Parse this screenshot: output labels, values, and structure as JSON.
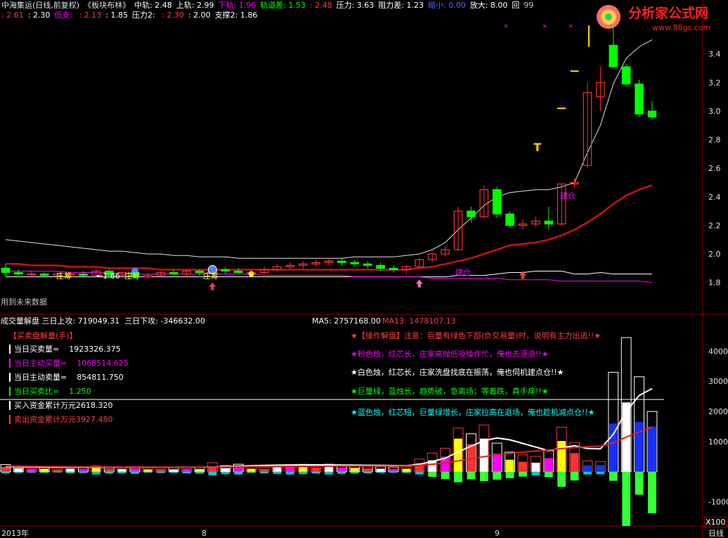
{
  "header": {
    "line1": [
      {
        "text": "中海集运(日线,前复权)",
        "color": "#e0e0e0"
      },
      {
        "text": "《板块布林》",
        "color": "#e0e0e0"
      },
      {
        "text": "中轨: 2.48",
        "color": "#ffffff"
      },
      {
        "text": "上轨: 2.99",
        "color": "#ffffff"
      },
      {
        "text": "下轨: 1.96",
        "color": "#ff00ff"
      },
      {
        "text": "轨道差: 1.53",
        "color": "#00ff00"
      },
      {
        "text": ": 2.48",
        "color": "#ff3c3c"
      },
      {
        "text": "压力: 3.63",
        "color": "#ffffff"
      },
      {
        "text": "阻力差: 1.23",
        "color": "#ffffff"
      },
      {
        "text": "缩小: 0.00",
        "color": "#4b6bff"
      },
      {
        "text": "放大: 8.00",
        "color": "#ffffff"
      },
      {
        "text": "回",
        "color": "#ffffff"
      },
      {
        "text": "99",
        "color": "#c0c0c0"
      }
    ],
    "line2": [
      {
        "text": ": 2.61",
        "color": "#ff3c3c"
      },
      {
        "text": ": 2.30",
        "color": "#ffffff"
      },
      {
        "text": "低支: ",
        "color": "#ff00ff"
      },
      {
        "text": ": 2.13",
        "color": "#ff3c3c"
      },
      {
        "text": ": 1.85",
        "color": "#ffffff"
      },
      {
        "text": "压力2: ",
        "color": "#ffffff"
      },
      {
        "text": ": 2.30",
        "color": "#ff3c3c"
      },
      {
        "text": ": 2.00",
        "color": "#ffffff"
      },
      {
        "text": "支撑2: 1.86",
        "color": "#ffffff"
      }
    ]
  },
  "logo": {
    "text": "分析家公式网",
    "url": "www.88gs.com"
  },
  "price_axis": {
    "ticks": [
      "3.4",
      "3.2",
      "3.0",
      "2.8",
      "2.6",
      "2.4",
      "2.2",
      "2.0",
      "1.8"
    ]
  },
  "price_labels": {
    "zhuangchou": "庄筹",
    "low_value": "1.86",
    "jiancang_upper": "建仓",
    "jiancang_lower": "建仓",
    "future_data": "用到未来数据"
  },
  "volume_panel": {
    "title": "成交量解盘",
    "up_attack": "三日上攻: 719049.31",
    "down_attack": "三日下攻: -346632.00",
    "ma5": "MA5: 2757168.00",
    "ma13": "MA13: 1478107.13",
    "axis_ticks": [
      "4000",
      "3000",
      "2000",
      "1000",
      "-1000"
    ],
    "unit": "X100",
    "left_rows": [
      {
        "label": "【买卖盘解量(手)】",
        "value": "",
        "color": "#ff3c3c"
      },
      {
        "label": "当日买卖量=",
        "value": "1923326.375",
        "color": "#ffffff"
      },
      {
        "label": "当日主动买量=",
        "value": "1068514.625",
        "color": "#ff00ff"
      },
      {
        "label": "当日主动卖量=",
        "value": "854811.750",
        "color": "#ffffff"
      },
      {
        "label": "当日买卖比=",
        "value": "1.250",
        "color": "#00ff00"
      },
      {
        "label": "买入资金累计万元",
        "value": "2618.320",
        "color": "#ffffff"
      },
      {
        "label": "卖出资金累计万元",
        "value": "3927.480",
        "color": "#ff3c3c"
      }
    ],
    "notes": [
      {
        "text": "★【操作解盘】注意：巨量有绿色下部(负交易量)时，说明有主力出逃!!★",
        "color": "#ff3c3c"
      },
      {
        "text": "★粉色烛，红芯长，庄家高抛低吸操作忙，俺也去逐浪!!★",
        "color": "#ff00ff"
      },
      {
        "text": "★白色烛，红芯长，庄家洗盘找底在振荡，俺也伺机建点仓!!★",
        "color": "#ffffff"
      },
      {
        "text": "★巨量绿，蓝烛长，趋势破，急离场；等着跌，真手痒!!★",
        "color": "#00ff00"
      },
      {
        "text": "★蓝色烛，红芯短，巨量绿增长，庄家拉高在退场，俺也趁机减点仓!!★",
        "color": "#00ffff"
      }
    ]
  },
  "time_axis": {
    "labels": [
      "2013年",
      "8",
      "9"
    ],
    "period": "日线"
  },
  "chart_data": [
    {
      "type": "candlestick",
      "title": "中海集运(日线,前复权)",
      "ylim": [
        1.72,
        3.63
      ],
      "candles": [
        [
          1.9,
          1.93,
          1.84,
          1.87
        ],
        [
          1.87,
          1.89,
          1.85,
          1.86
        ],
        [
          1.86,
          1.88,
          1.84,
          1.86
        ],
        [
          1.86,
          1.87,
          1.84,
          1.85
        ],
        [
          1.85,
          1.87,
          1.84,
          1.86
        ],
        [
          1.86,
          1.88,
          1.85,
          1.86
        ],
        [
          1.86,
          1.88,
          1.84,
          1.85
        ],
        [
          1.85,
          1.9,
          1.84,
          1.88
        ],
        [
          1.88,
          1.89,
          1.84,
          1.85
        ],
        [
          1.85,
          1.88,
          1.84,
          1.87
        ],
        [
          1.87,
          1.88,
          1.83,
          1.84
        ],
        [
          1.84,
          1.86,
          1.83,
          1.85
        ],
        [
          1.85,
          1.88,
          1.84,
          1.87
        ],
        [
          1.87,
          1.89,
          1.85,
          1.86
        ],
        [
          1.86,
          1.88,
          1.84,
          1.88
        ],
        [
          1.88,
          1.89,
          1.85,
          1.87
        ],
        [
          1.87,
          1.9,
          1.86,
          1.89
        ],
        [
          1.89,
          1.91,
          1.86,
          1.88
        ],
        [
          1.88,
          1.9,
          1.86,
          1.87
        ],
        [
          1.87,
          1.89,
          1.85,
          1.87
        ],
        [
          1.87,
          1.91,
          1.86,
          1.89
        ],
        [
          1.89,
          1.93,
          1.88,
          1.91
        ],
        [
          1.91,
          1.94,
          1.89,
          1.92
        ],
        [
          1.92,
          1.95,
          1.9,
          1.93
        ],
        [
          1.93,
          1.96,
          1.91,
          1.94
        ],
        [
          1.94,
          1.97,
          1.92,
          1.95
        ],
        [
          1.95,
          1.97,
          1.92,
          1.94
        ],
        [
          1.94,
          1.96,
          1.91,
          1.93
        ],
        [
          1.93,
          1.95,
          1.9,
          1.92
        ],
        [
          1.92,
          1.94,
          1.88,
          1.9
        ],
        [
          1.9,
          1.92,
          1.87,
          1.89
        ],
        [
          1.89,
          1.92,
          1.86,
          1.91
        ],
        [
          1.91,
          1.97,
          1.9,
          1.96
        ],
        [
          1.96,
          2.01,
          1.94,
          2.0
        ],
        [
          2.0,
          2.05,
          1.98,
          2.03
        ],
        [
          2.03,
          2.33,
          2.02,
          2.3
        ],
        [
          2.3,
          2.33,
          2.22,
          2.26
        ],
        [
          2.26,
          2.48,
          2.25,
          2.45
        ],
        [
          2.45,
          2.47,
          2.25,
          2.28
        ],
        [
          2.28,
          2.3,
          2.18,
          2.2
        ],
        [
          2.2,
          2.24,
          2.17,
          2.21
        ],
        [
          2.21,
          2.26,
          2.19,
          2.23
        ],
        [
          2.23,
          2.33,
          2.17,
          2.21
        ],
        [
          2.21,
          2.49,
          2.2,
          2.49
        ],
        [
          2.49,
          2.53,
          2.46,
          2.5
        ],
        [
          2.62,
          3.2,
          2.6,
          3.13
        ],
        [
          3.1,
          3.31,
          3.0,
          3.2
        ],
        [
          3.46,
          3.6,
          3.3,
          3.31
        ],
        [
          3.31,
          3.33,
          3.17,
          3.19
        ],
        [
          3.19,
          3.22,
          2.96,
          2.98
        ],
        [
          3.0,
          3.07,
          2.94,
          2.96
        ]
      ],
      "series": [
        {
          "name": "上轨",
          "values": [
            2.1,
            2.09,
            2.08,
            2.07,
            2.06,
            2.05,
            2.04,
            2.03,
            2.02,
            2.02,
            2.01,
            2.0,
            2.0,
            1.99,
            1.99,
            1.98,
            1.98,
            1.98,
            1.97,
            1.97,
            1.97,
            1.97,
            1.97,
            1.97,
            1.97,
            1.97,
            1.97,
            1.98,
            1.98,
            1.98,
            1.98,
            1.99,
            2.0,
            2.03,
            2.08,
            2.17,
            2.25,
            2.34,
            2.4,
            2.43,
            2.44,
            2.45,
            2.45,
            2.47,
            2.5,
            2.71,
            2.9,
            3.19,
            3.37,
            3.45,
            3.5
          ]
        },
        {
          "name": "下轨",
          "values": [
            1.84,
            1.84,
            1.84,
            1.84,
            1.84,
            1.84,
            1.84,
            1.84,
            1.84,
            1.84,
            1.84,
            1.84,
            1.84,
            1.84,
            1.84,
            1.84,
            1.84,
            1.84,
            1.84,
            1.84,
            1.84,
            1.84,
            1.84,
            1.84,
            1.84,
            1.84,
            1.84,
            1.84,
            1.84,
            1.84,
            1.84,
            1.84,
            1.84,
            1.84,
            1.84,
            1.85,
            1.85,
            1.85,
            1.86,
            1.87,
            1.87,
            1.88,
            1.88,
            1.88,
            1.86,
            1.86,
            1.87,
            1.86,
            1.86,
            1.86,
            1.86
          ]
        },
        {
          "name": "中轨",
          "values": [
            1.93,
            1.93,
            1.92,
            1.92,
            1.92,
            1.91,
            1.91,
            1.91,
            1.9,
            1.9,
            1.9,
            1.9,
            1.89,
            1.89,
            1.89,
            1.89,
            1.89,
            1.89,
            1.89,
            1.89,
            1.89,
            1.89,
            1.89,
            1.89,
            1.89,
            1.89,
            1.89,
            1.89,
            1.89,
            1.89,
            1.89,
            1.89,
            1.9,
            1.91,
            1.93,
            1.95,
            1.97,
            2.0,
            2.03,
            2.06,
            2.07,
            2.08,
            2.1,
            2.13,
            2.17,
            2.22,
            2.28,
            2.35,
            2.41,
            2.45,
            2.48
          ]
        },
        {
          "name": "轨道差",
          "values": [
            1.88,
            1.88,
            1.88,
            1.88,
            1.88,
            1.87,
            1.87,
            1.87,
            1.87,
            1.86,
            1.86,
            1.86,
            1.86,
            1.86,
            1.86,
            1.86,
            1.86,
            1.86,
            1.86,
            1.86,
            1.85,
            1.85,
            1.85,
            1.85,
            1.85,
            1.85,
            1.85,
            1.84,
            1.84,
            1.84,
            1.84,
            1.84,
            1.84,
            1.83,
            1.83,
            1.83,
            1.83,
            1.83,
            1.83,
            1.82,
            1.82,
            1.82,
            1.82,
            1.81,
            1.81,
            1.81,
            1.81,
            1.81,
            1.81,
            1.81,
            1.8
          ]
        }
      ]
    },
    {
      "type": "bar",
      "title": "成交量解盘",
      "ylim": [
        -1800,
        4800
      ],
      "series": [
        {
          "name": "成交量",
          "values": [
            240,
            180,
            160,
            150,
            130,
            150,
            140,
            200,
            160,
            150,
            170,
            130,
            150,
            140,
            160,
            150,
            300,
            200,
            250,
            160,
            150,
            220,
            240,
            250,
            210,
            260,
            220,
            200,
            180,
            170,
            160,
            170,
            420,
            620,
            780,
            1450,
            1260,
            1550,
            950,
            650,
            560,
            510,
            700,
            1480,
            970,
            360,
            340,
            3300,
            4450,
            3150,
            2000
          ]
        },
        {
          "name": "主动买",
          "values": [
            160,
            120,
            110,
            100,
            80,
            100,
            90,
            140,
            100,
            90,
            110,
            80,
            90,
            80,
            100,
            90,
            180,
            120,
            160,
            100,
            90,
            150,
            160,
            170,
            140,
            180,
            140,
            130,
            110,
            100,
            90,
            100,
            280,
            380,
            500,
            1100,
            920,
            1100,
            600,
            400,
            330,
            300,
            450,
            1020,
            620,
            210,
            220,
            1600,
            2300,
            1650,
            1500
          ]
        },
        {
          "name": "主动卖",
          "values": [
            -50,
            -40,
            -30,
            -40,
            -20,
            -50,
            -40,
            -90,
            -60,
            -50,
            -70,
            -30,
            -40,
            -40,
            -50,
            -60,
            -120,
            -80,
            -90,
            -40,
            -50,
            -70,
            -90,
            -80,
            -60,
            -90,
            -70,
            -60,
            -50,
            -40,
            -30,
            -40,
            -90,
            -170,
            -240,
            -350,
            -250,
            -310,
            -260,
            -210,
            -160,
            -120,
            -180,
            -500,
            -290,
            -90,
            -80,
            -300,
            -1800,
            -760,
            -1380
          ]
        },
        {
          "name": "MA5",
          "values": [
            170,
            165,
            160,
            155,
            150,
            150,
            150,
            155,
            150,
            150,
            155,
            150,
            150,
            150,
            150,
            150,
            160,
            170,
            190,
            200,
            210,
            220,
            225,
            230,
            230,
            230,
            225,
            220,
            215,
            210,
            205,
            200,
            250,
            340,
            450,
            660,
            850,
            1030,
            1120,
            1060,
            940,
            820,
            700,
            800,
            860,
            770,
            760,
            1240,
            2000,
            2530,
            2757
          ]
        },
        {
          "name": "MA13",
          "values": [
            190,
            185,
            180,
            175,
            170,
            168,
            165,
            163,
            160,
            158,
            156,
            155,
            153,
            152,
            150,
            150,
            155,
            160,
            165,
            170,
            172,
            175,
            178,
            180,
            182,
            185,
            187,
            190,
            190,
            190,
            190,
            190,
            215,
            250,
            290,
            360,
            430,
            500,
            560,
            610,
            650,
            690,
            720,
            770,
            800,
            830,
            850,
            960,
            1150,
            1320,
            1478
          ]
        }
      ]
    }
  ],
  "colors": {
    "up": "#ff3030",
    "down": "#00ff00",
    "upper_band": "#e0e0e0",
    "middle_band": "#e8e8e8",
    "lower_band": "#ff00ff",
    "ma13": "#cc1111",
    "grid": "#8b0000",
    "axis_text": "#e0e0e0"
  }
}
